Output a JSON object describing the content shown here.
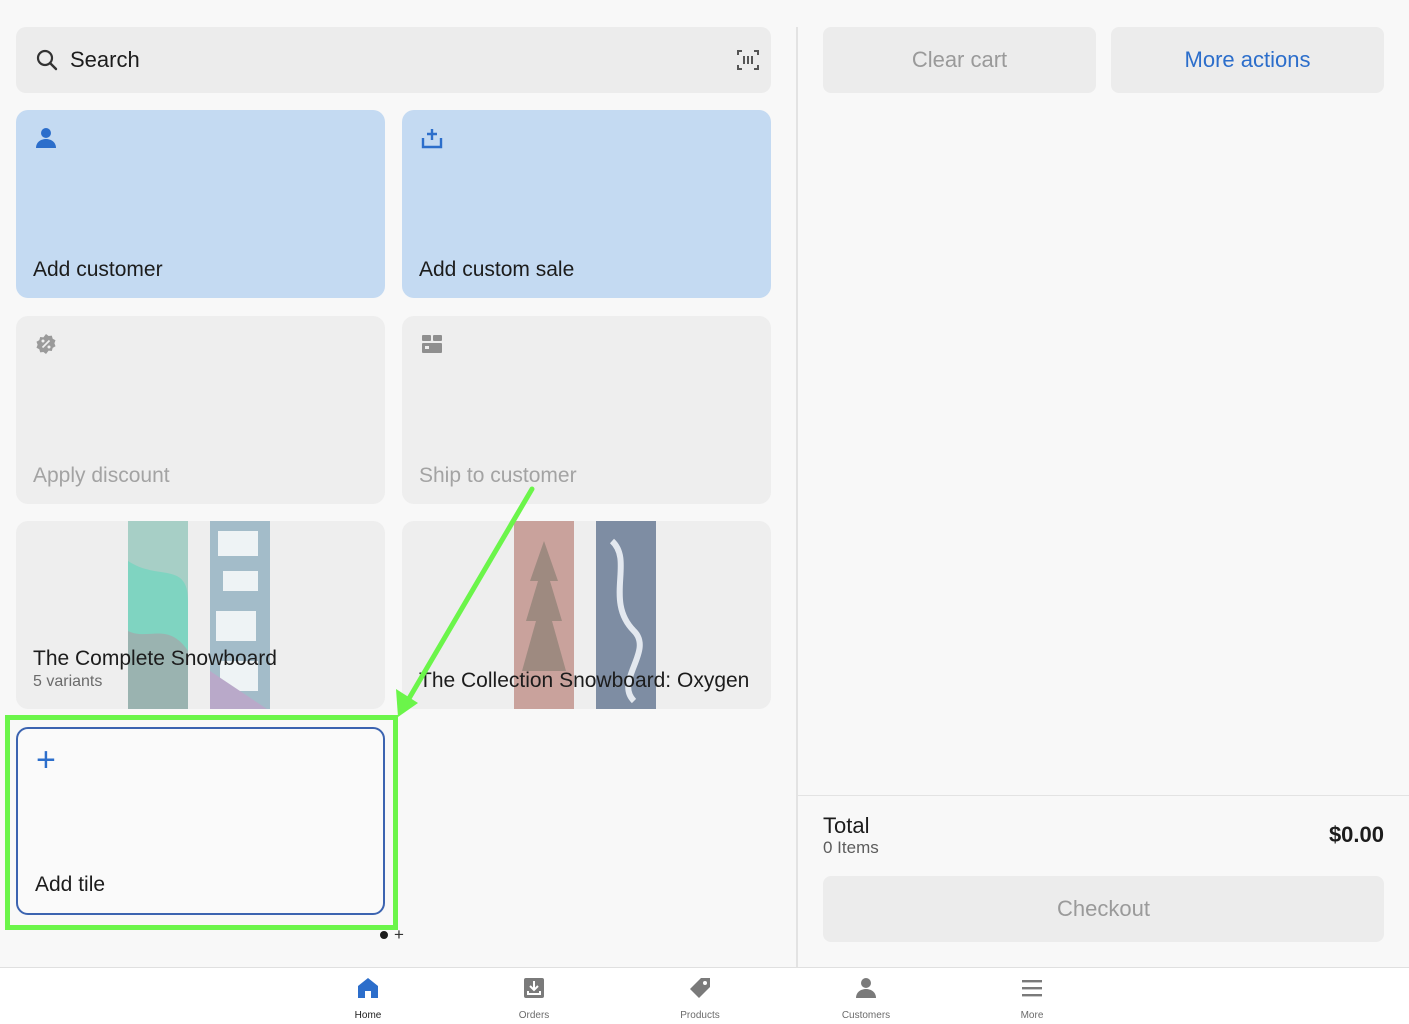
{
  "search": {
    "placeholder": "Search"
  },
  "tiles": {
    "add_customer": "Add customer",
    "add_custom_sale": "Add custom sale",
    "apply_discount": "Apply discount",
    "ship_to_customer": "Ship to customer",
    "add_tile": "Add tile"
  },
  "products": [
    {
      "title": "The Complete Snowboard",
      "subtitle": "5 variants"
    },
    {
      "title": "The Collection Snowboard: Oxygen",
      "subtitle": ""
    }
  ],
  "cart": {
    "clear_cart": "Clear cart",
    "more_actions": "More actions",
    "total_label": "Total",
    "items_label": "0 Items",
    "total_value": "$0.00",
    "checkout": "Checkout"
  },
  "nav": {
    "home": "Home",
    "orders": "Orders",
    "products": "Products",
    "customers": "Customers",
    "more": "More"
  },
  "colors": {
    "accent": "#2c6ecb",
    "highlight": "#6bf54a",
    "blue_tile": "#c4daf2"
  }
}
